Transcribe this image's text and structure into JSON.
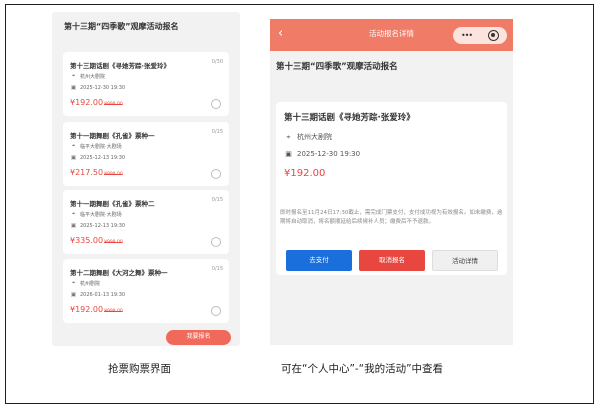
{
  "left": {
    "title": "第十三期“四季歌”观摩活动报名",
    "cards": [
      {
        "name": "第十三期话剧《寻她芳踪·张爱玲》",
        "count": "0/30",
        "venue": "杭州大剧院",
        "datetime": "2025-12-30 19:30",
        "price": "¥192.00",
        "old_price": "¥999.00"
      },
      {
        "name": "第十一期舞剧《孔雀》票种一",
        "count": "0/15",
        "venue": "临平大剧院·大剧场",
        "datetime": "2025-12-13 19:30",
        "price": "¥217.50",
        "old_price": "¥999.00"
      },
      {
        "name": "第十一期舞剧《孔雀》票种二",
        "count": "0/15",
        "venue": "临平大剧院·大剧场",
        "datetime": "2025-12-13 19:30",
        "price": "¥335.00",
        "old_price": "¥999.00"
      },
      {
        "name": "第十二期舞剧《大河之舞》票种一",
        "count": "0/15",
        "venue": "杭州剧院",
        "datetime": "2026-01-13 19:30",
        "price": "¥192.00",
        "old_price": "¥999.00"
      }
    ],
    "signup_button": "我要报名",
    "caption": "抢票购票界面"
  },
  "right": {
    "header_title": "活动报名详情",
    "page_title": "第十三期“四季歌”观摩活动报名",
    "detail": {
      "name": "第十三期话剧《寻她芳踪·张爱玲》",
      "venue": "杭州大剧院",
      "datetime": "2025-12-30 19:30",
      "price": "¥192.00"
    },
    "notice": "即时报名至11月24日17:30截止，需完成门票支付，支付成功视为有效报名。如未缴费，逾期将自动取消，将名额顺延给后续候补人员；缴费后不予退款。",
    "buttons": {
      "pay": "去支付",
      "cancel": "取消报名",
      "detail": "活动详情"
    },
    "caption": "可在“个人中心”-“我的活动”中查看"
  },
  "colors": {
    "header": "#f07b66",
    "accent_red": "#e8473f",
    "pay_blue": "#1a6fdc"
  },
  "icons": {
    "location": "location-pin-icon",
    "calendar": "calendar-icon",
    "back": "back-arrow-icon",
    "more": "more-dots-icon",
    "close": "capsule-close-icon"
  }
}
